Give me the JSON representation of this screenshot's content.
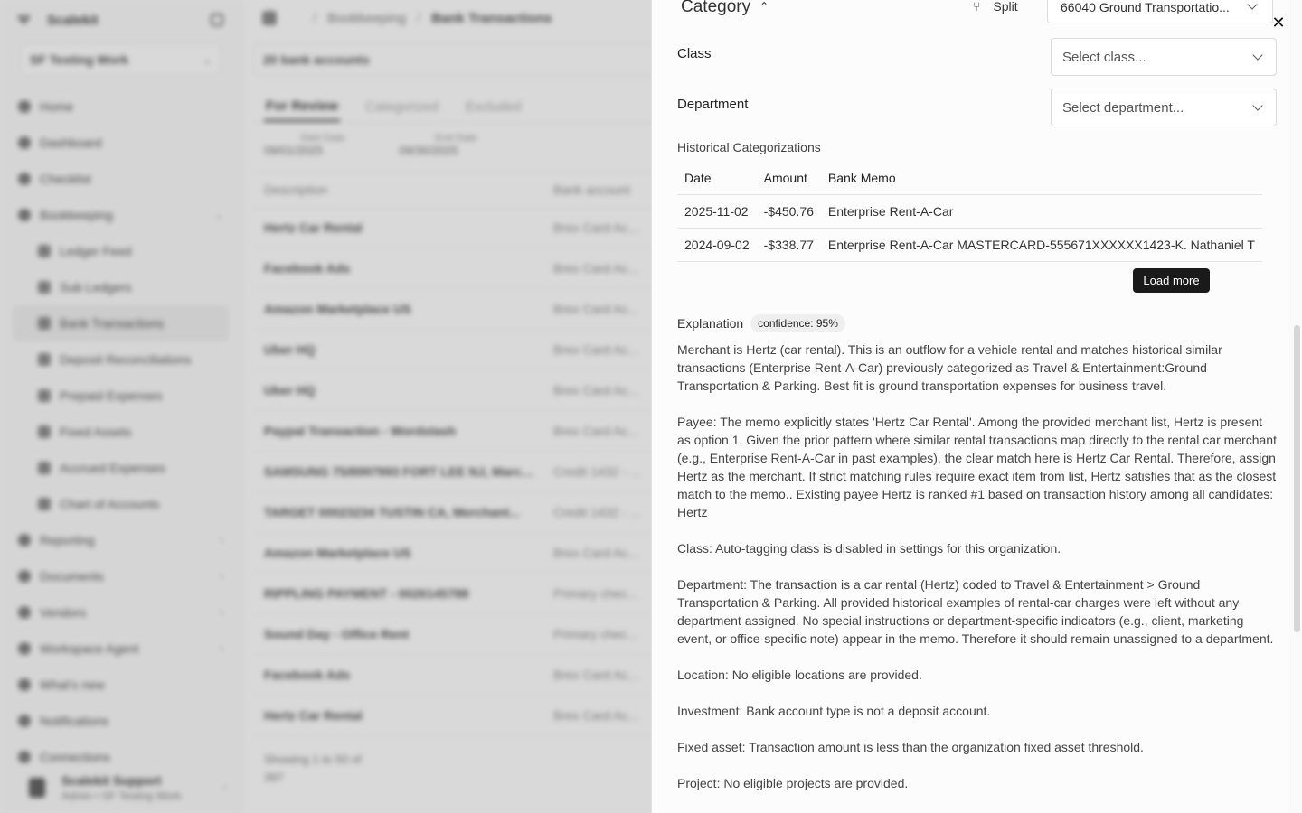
{
  "background": {
    "brand": "Scalekit",
    "org": "SF Testing Work",
    "nav": [
      {
        "label": "Home"
      },
      {
        "label": "Dashboard"
      },
      {
        "label": "Checklist"
      },
      {
        "label": "Bookkeeping",
        "arrow": "⌄"
      }
    ],
    "subnav": [
      {
        "label": "Ledger Feed"
      },
      {
        "label": "Sub Ledgers"
      },
      {
        "label": "Bank Transactions",
        "active": true
      },
      {
        "label": "Deposit Reconciliations"
      },
      {
        "label": "Prepaid Expenses"
      },
      {
        "label": "Fixed Assets"
      },
      {
        "label": "Accrued Expenses"
      },
      {
        "label": "Chart of Accounts"
      }
    ],
    "nav2": [
      {
        "label": "Reporting",
        "arrow": "›"
      },
      {
        "label": "Documents",
        "arrow": "›"
      },
      {
        "label": "Vendors",
        "arrow": "›"
      },
      {
        "label": "Workspace Agent",
        "arrow": "›"
      },
      {
        "label": "What's new",
        "arrow": ""
      },
      {
        "label": "Notifications",
        "arrow": ""
      },
      {
        "label": "Connections",
        "arrow": ""
      }
    ],
    "user": {
      "name": "Scalekit Support",
      "sub": "Admin • SF Testing Work"
    },
    "breadcrumb": {
      "parent": "Bookkeeping",
      "current": "Bank Transactions"
    },
    "account_bar": "20 bank accounts",
    "tabs": [
      "For Review",
      "Categorized",
      "Excluded"
    ],
    "filters": [
      {
        "label": "Start Date",
        "value": "09/01/2025"
      },
      {
        "label": "End Date",
        "value": "09/30/2025"
      }
    ],
    "columns": [
      "Description",
      "Bank account"
    ],
    "rows": [
      {
        "desc": "Hertz Car Rental",
        "acct": "Brex Card Ac..."
      },
      {
        "desc": "Facebook Ads",
        "acct": "Brex Card Ac..."
      },
      {
        "desc": "Amazon Marketplace US",
        "acct": "Brex Card Ac..."
      },
      {
        "desc": "Uber HQ",
        "acct": "Brex Card Ac..."
      },
      {
        "desc": "Uber HQ",
        "acct": "Brex Card Ac..."
      },
      {
        "desc": "Paypal Transaction - Wordstash",
        "acct": "Brex Card Ac..."
      },
      {
        "desc": "SAMSUNG 75/8997993 FORT LEE NJ, Marcha...",
        "acct": "Credit 1432 - ..."
      },
      {
        "desc": "TARGET 00023234 TUSTIN CA, Merchant...",
        "acct": "Credit 1432 - ..."
      },
      {
        "desc": "Amazon Marketplace US",
        "acct": "Brex Card Ac..."
      },
      {
        "desc": "RIPPLING PAYMENT - 0026145788",
        "acct": "Primary chec..."
      },
      {
        "desc": "Sound Day - Office Rent",
        "acct": "Primary chec..."
      },
      {
        "desc": "Facebook Ads",
        "acct": "Brex Card Ac..."
      },
      {
        "desc": "Hertz Car Rental",
        "acct": "Brex Card Ac..."
      }
    ],
    "footer": "Showing 1 to 50 of 397"
  },
  "drawer": {
    "category_title": "Category",
    "split_label": "Split",
    "category_value": "66040 Ground Transportatio...",
    "class_label": "Class",
    "class_placeholder": "Select class...",
    "department_label": "Department",
    "department_placeholder": "Select department...",
    "history_title": "Historical Categorizations",
    "history_columns": [
      "Date",
      "Amount",
      "Bank Memo"
    ],
    "history_rows": [
      {
        "date": "2025-11-02",
        "amount": "-$450.76",
        "memo": "Enterprise Rent-A-Car"
      },
      {
        "date": "2024-09-02",
        "amount": "-$338.77",
        "memo": "Enterprise Rent-A-Car MASTERCARD-555671XXXXXX1423-K. Nathaniel T"
      }
    ],
    "load_more": "Load more",
    "explanation_title": "Explanation",
    "confidence": "confidence: 95%",
    "explanation": [
      "Merchant is Hertz (car rental). This is an outflow for a vehicle rental and matches historical similar transactions (Enterprise Rent-A-Car) previously categorized as Travel & Entertainment:Ground Transportation & Parking. Best fit is ground transportation expenses for business travel.",
      "Payee: The memo explicitly states 'Hertz Car Rental'. Among the provided merchant list, Hertz is present as option 1. Given the prior pattern where similar rental transactions map directly to the rental car merchant (e.g., Enterprise Rent-A-Car in past examples), the clear match here is Hertz Car Rental. Therefore, assign Hertz as the merchant. If strict matching rules require exact item from list, Hertz satisfies that as the closest match to the memo.. Existing payee Hertz is ranked #1 based on transaction history among all candidates: Hertz",
      "Class: Auto-tagging class is disabled in settings for this organization.",
      "Department: The transaction is a car rental (Hertz) coded to Travel & Entertainment > Ground Transportation & Parking. All provided historical examples of rental-car charges were left without any department assigned. No special instructions or department-specific indicators (e.g., client, marketing event, or office-specific note) appear in the memo. Therefore it should remain unassigned to a department.",
      "Location: No eligible locations are provided.",
      "Investment: Bank account type is not a deposit account.",
      "Fixed asset: Transaction amount is less than the organization fixed asset threshold.",
      "Project: No eligible projects are provided."
    ],
    "close_glyph": "✕",
    "split_glyph": "⑂",
    "chevron_up_glyph": "⌃"
  }
}
